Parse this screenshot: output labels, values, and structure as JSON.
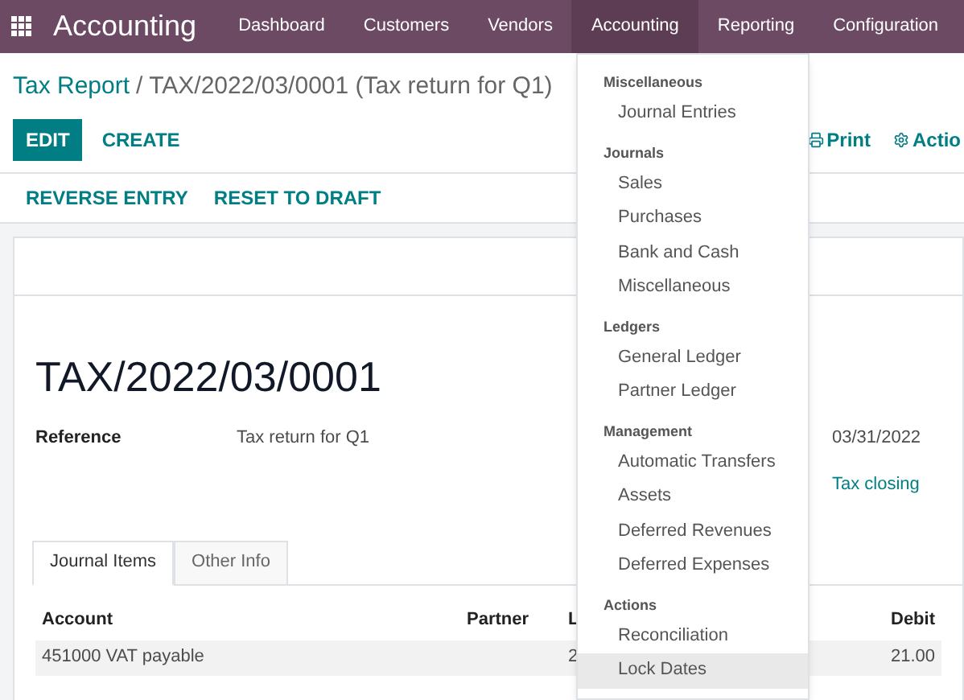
{
  "nav": {
    "app_title": "Accounting",
    "items": [
      {
        "label": "Dashboard",
        "selected": false
      },
      {
        "label": "Customers",
        "selected": false
      },
      {
        "label": "Vendors",
        "selected": false
      },
      {
        "label": "Accounting",
        "selected": true
      },
      {
        "label": "Reporting",
        "selected": false
      },
      {
        "label": "Configuration",
        "selected": false
      }
    ]
  },
  "breadcrumb": {
    "parent": "Tax Report",
    "current": "/ TAX/2022/03/0001 (Tax return for Q1)"
  },
  "buttons": [
    {
      "label": "EDIT",
      "kind": "primary"
    },
    {
      "label": "CREATE",
      "kind": "link"
    }
  ],
  "right_actions": [
    {
      "label": "Print",
      "kind": "print"
    },
    {
      "label": "Actio",
      "kind": "action"
    }
  ],
  "status_buttons": [
    "REVERSE ENTRY",
    "RESET TO DRAFT"
  ],
  "record": {
    "title": "TAX/2022/03/0001",
    "fields": [
      {
        "label": "Reference",
        "value": "Tax return for Q1"
      }
    ],
    "date": "03/31/2022",
    "journal": "Tax closing"
  },
  "tabs": [
    {
      "label": "Journal Items",
      "selected": true
    },
    {
      "label": "Other Info",
      "selected": false
    }
  ],
  "table": {
    "columns": [
      "Account",
      "Partner",
      "L",
      "Debit"
    ],
    "rows": [
      {
        "cells": [
          "451000 VAT payable",
          "",
          "2",
          "21.00"
        ]
      }
    ]
  },
  "menu": {
    "sections": [
      {
        "heading": "Miscellaneous",
        "items": [
          {
            "label": "Journal Entries",
            "hovered": false
          }
        ]
      },
      {
        "heading": "Journals",
        "items": [
          {
            "label": "Sales",
            "hovered": false
          },
          {
            "label": "Purchases",
            "hovered": false
          },
          {
            "label": "Bank and Cash",
            "hovered": false
          },
          {
            "label": "Miscellaneous",
            "hovered": false
          }
        ]
      },
      {
        "heading": "Ledgers",
        "items": [
          {
            "label": "General Ledger",
            "hovered": false
          },
          {
            "label": "Partner Ledger",
            "hovered": false
          }
        ]
      },
      {
        "heading": "Management",
        "items": [
          {
            "label": "Automatic Transfers",
            "hovered": false
          },
          {
            "label": "Assets",
            "hovered": false
          },
          {
            "label": "Deferred Revenues",
            "hovered": false
          },
          {
            "label": "Deferred Expenses",
            "hovered": false
          }
        ]
      },
      {
        "heading": "Actions",
        "items": [
          {
            "label": "Reconciliation",
            "hovered": false
          },
          {
            "label": "Lock Dates",
            "hovered": true
          }
        ]
      }
    ]
  }
}
